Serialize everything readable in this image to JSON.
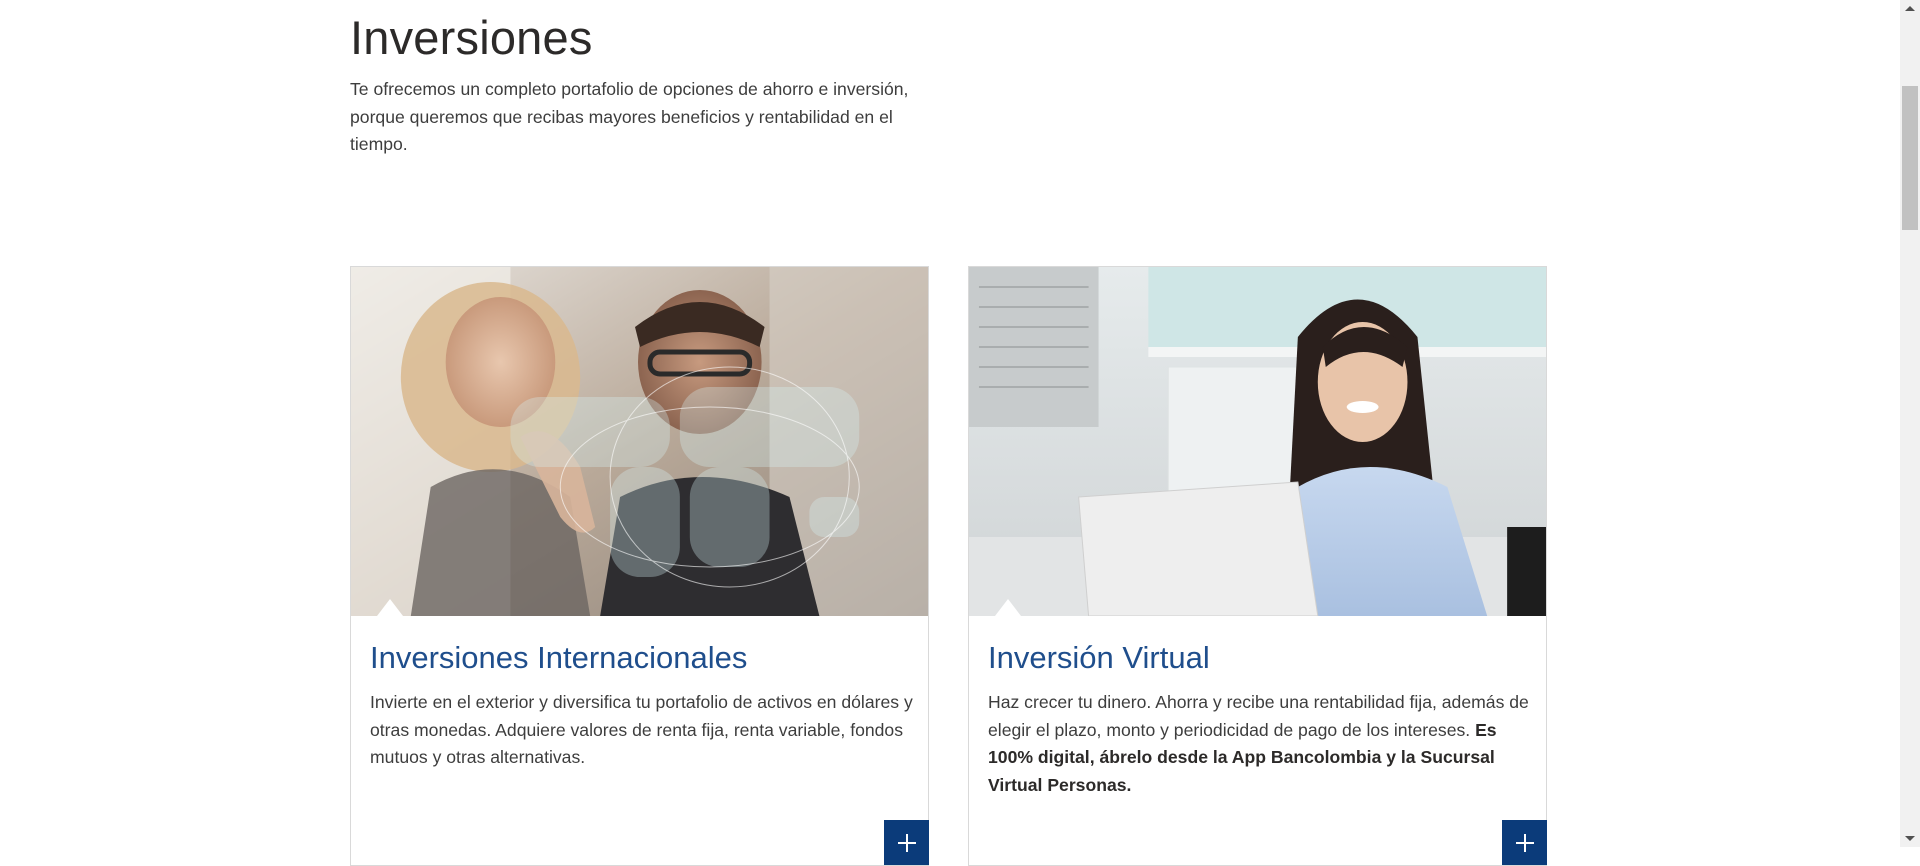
{
  "header": {
    "title": "Inversiones",
    "intro": "Te ofrecemos un completo portafolio de opciones de ahorro e inversión, porque queremos que recibas mayores beneficios y rentabilidad en el tiempo."
  },
  "cards": [
    {
      "title": "Inversiones Internacionales",
      "description": "Invierte en el exterior y diversifica tu portafolio de activos en dólares y otras monedas. Adquiere valores de renta fija, renta variable, fondos mutuos  y otras alternativas.",
      "image_icon": "world-map-photo",
      "button_icon": "plus-icon"
    },
    {
      "title": "Inversión Virtual",
      "description": "Haz crecer tu dinero. Ahorra y recibe una rentabilidad fija, además de elegir el plazo, monto y periodicidad de pago de los intereses. ",
      "description_bold": "Es 100% digital, ábrelo desde la App Bancolombia y la Sucursal Virtual Personas.",
      "image_icon": "woman-laptop-photo",
      "button_icon": "plus-icon"
    }
  ],
  "colors": {
    "title_blue": "#1f4e8c",
    "button_blue": "#0b3b7a",
    "text": "#3d3d3d"
  }
}
